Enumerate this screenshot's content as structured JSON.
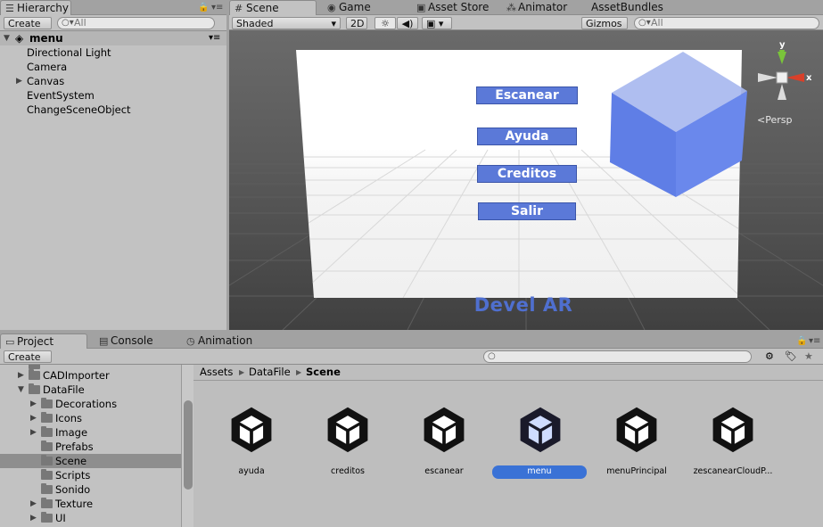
{
  "hierarchy": {
    "tab_label": "Hierarchy",
    "create_label": "Create",
    "search_placeholder": "All",
    "scene_name": "menu",
    "items": [
      {
        "label": "Directional Light"
      },
      {
        "label": "Camera"
      },
      {
        "label": "Canvas"
      },
      {
        "label": "EventSystem"
      },
      {
        "label": "ChangeSceneObject"
      }
    ]
  },
  "scene_tabs": {
    "scene": "Scene",
    "game": "Game",
    "asset_store": "Asset Store",
    "animator": "Animator",
    "asset_bundles": "AssetBundles"
  },
  "scene_toolbar": {
    "shading_mode": "Shaded",
    "mode_2d": "2D",
    "gizmos_label": "Gizmos",
    "search_placeholder": "All"
  },
  "gizmo": {
    "y_label": "y",
    "x_label": "x",
    "persp_label": "Persp"
  },
  "canvas_ui": {
    "buttons": [
      "Escanear",
      "Ayuda",
      "Creditos",
      "Salir"
    ],
    "logo_text": "Devel AR"
  },
  "bottom_tabs": {
    "project": "Project",
    "console": "Console",
    "animation": "Animation"
  },
  "project": {
    "create_label": "Create",
    "tree": [
      {
        "label": "CADImporter"
      },
      {
        "label": "DataFile"
      },
      {
        "label": "Decorations"
      },
      {
        "label": "Icons"
      },
      {
        "label": "Image"
      },
      {
        "label": "Prefabs"
      },
      {
        "label": "Scene"
      },
      {
        "label": "Scripts"
      },
      {
        "label": "Sonido"
      },
      {
        "label": "Texture"
      },
      {
        "label": "UI"
      }
    ],
    "breadcrumb": [
      "Assets",
      "DataFile",
      "Scene"
    ],
    "assets": [
      {
        "label": "ayuda"
      },
      {
        "label": "creditos"
      },
      {
        "label": "escanear"
      },
      {
        "label": "menu"
      },
      {
        "label": "menuPrincipal"
      },
      {
        "label": "zescanearCloudP..."
      }
    ],
    "selected_asset": "menu"
  },
  "colors": {
    "panel_bg": "#c2c2c2",
    "viewport_bg": "#4a4a4a",
    "ui_button": "#5b79d8",
    "cube": "#6b86e8",
    "selection": "#3a72d6",
    "gizmo_x": "#d8402a",
    "gizmo_y": "#7ac43a"
  }
}
